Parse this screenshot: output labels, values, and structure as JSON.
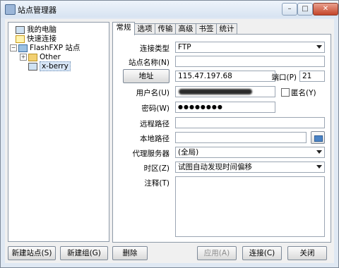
{
  "window": {
    "title": "站点管理器",
    "min": "–",
    "max": "□",
    "close": "✕"
  },
  "tree": {
    "items": [
      {
        "label": "我的电脑"
      },
      {
        "label": "快速连接"
      },
      {
        "label": "FlashFXP 站点"
      },
      {
        "label": "Other"
      },
      {
        "label": "x-berry"
      }
    ],
    "expander_plus": "+",
    "expander_minus": "−"
  },
  "tabs": [
    {
      "label": "常规"
    },
    {
      "label": "选项"
    },
    {
      "label": "传输"
    },
    {
      "label": "高级"
    },
    {
      "label": "书签"
    },
    {
      "label": "统计"
    }
  ],
  "form": {
    "conn_type_label": "连接类型",
    "conn_type_value": "FTP",
    "site_name_label": "站点名称(N)",
    "site_name_value": "",
    "address_button": "地址",
    "address_value": "115.47.197.68",
    "port_label": "端口(P)",
    "port_value": "21",
    "username_label": "用户名(U)",
    "anonymous_label": "匿名(Y)",
    "password_label": "密码(W)",
    "password_value": "●●●●●●●●",
    "remote_path_label": "远程路径",
    "local_path_label": "本地路径",
    "proxy_label": "代理服务器",
    "proxy_value": "(全局)",
    "timezone_label": "时区(Z)",
    "timezone_value": "试图自动发现时间偏移",
    "notes_label": "注释(T)"
  },
  "buttons": {
    "new_site": "新建站点(S)",
    "new_group": "新建组(G)",
    "delete": "删除",
    "apply": "应用(A)",
    "connect": "连接(C)",
    "close": "关闭"
  }
}
